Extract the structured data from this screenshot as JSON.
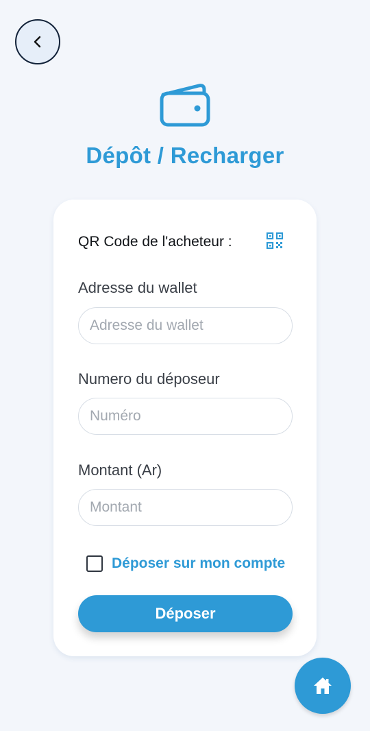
{
  "header": {
    "back_icon": "chevron-left-icon",
    "hero_icon": "wallet-icon",
    "title": "Dépôt / Recharger"
  },
  "form": {
    "qr_label": "QR Code de l'acheteur :",
    "qr_icon": "qr-code-icon",
    "wallet_address": {
      "label": "Adresse du wallet",
      "placeholder": "Adresse du wallet",
      "value": ""
    },
    "depositor_number": {
      "label": "Numero du déposeur",
      "placeholder": "Numéro",
      "value": ""
    },
    "amount": {
      "label": "Montant (Ar)",
      "placeholder": "Montant",
      "value": ""
    },
    "self_deposit": {
      "label": "Déposer sur mon compte",
      "checked": false
    },
    "submit_label": "Déposer"
  },
  "fab": {
    "icon": "home-icon"
  },
  "colors": {
    "accent": "#2e9ad6",
    "background": "#f3f6fb",
    "card": "#ffffff"
  }
}
